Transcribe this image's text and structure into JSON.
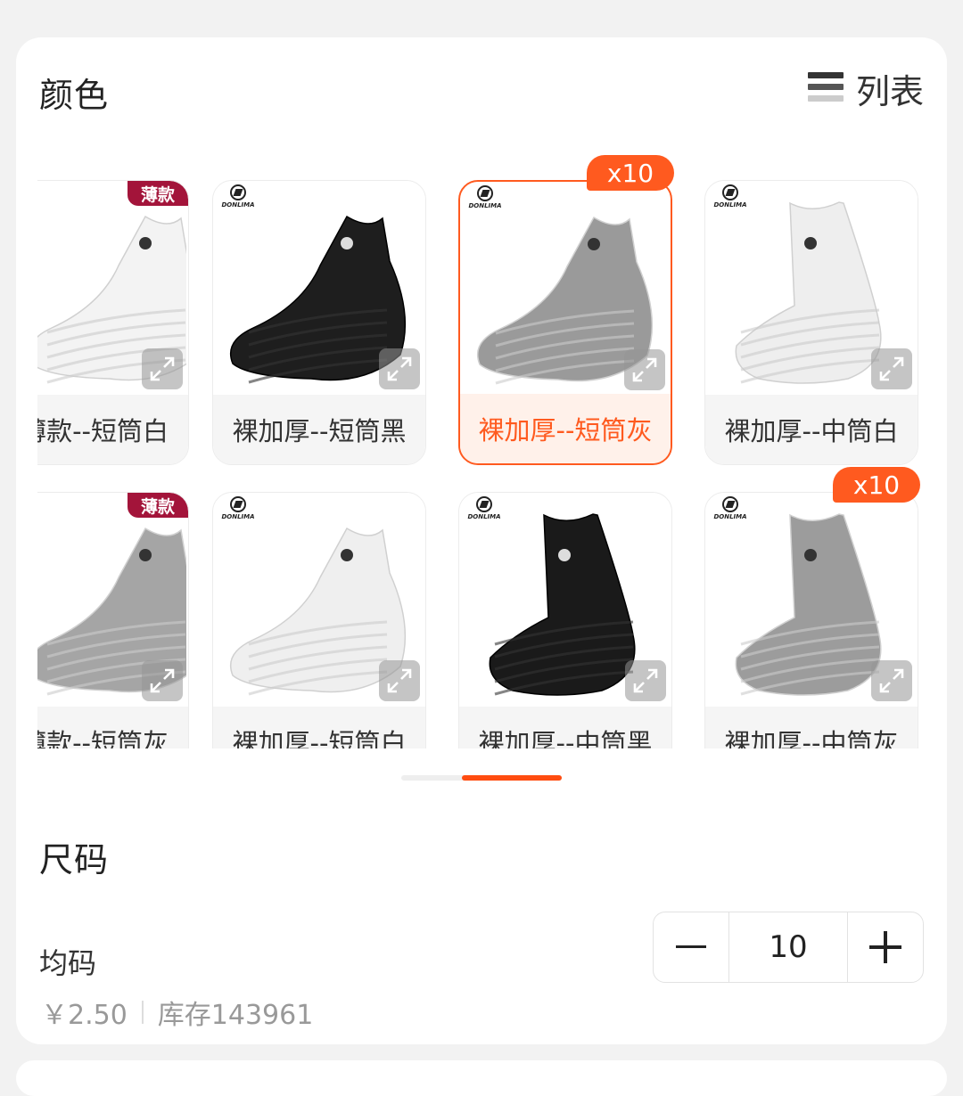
{
  "color_section": {
    "title": "颜色",
    "list_toggle_label": "列表",
    "items": [
      {
        "label": "薄款--短筒白",
        "display_label": "薄款--短筒白",
        "badge": "薄款",
        "qty_badge": "",
        "sock": "low",
        "shade": "#f3f3f3",
        "selected": false,
        "cut": true
      },
      {
        "label": "裸加厚--短筒黑",
        "display_label": "裸加厚--短筒黑",
        "badge": "",
        "qty_badge": "",
        "sock": "low",
        "shade": "#1e1e1e",
        "selected": false,
        "cut": false
      },
      {
        "label": "裸加厚--短筒灰",
        "display_label": "裸加厚--短筒灰",
        "badge": "",
        "qty_badge": "x10",
        "sock": "low",
        "shade": "#9a9a9a",
        "selected": true,
        "cut": false
      },
      {
        "label": "裸加厚--中筒白",
        "display_label": "裸加厚--中筒白",
        "badge": "",
        "qty_badge": "",
        "sock": "mid",
        "shade": "#eeeeee",
        "selected": false,
        "cut": false
      },
      {
        "label": "薄款--短筒灰",
        "display_label": "薄款--短筒灰",
        "badge": "薄款",
        "qty_badge": "",
        "sock": "low",
        "shade": "#a5a5a5",
        "selected": false,
        "cut": true
      },
      {
        "label": "裸加厚--短筒白",
        "display_label": "裸加厚--短筒白",
        "badge": "",
        "qty_badge": "",
        "sock": "low",
        "shade": "#efefef",
        "selected": false,
        "cut": false
      },
      {
        "label": "裸加厚--中筒黑",
        "display_label": "裸加厚--中筒黑",
        "badge": "",
        "qty_badge": "",
        "sock": "mid",
        "shade": "#1a1a1a",
        "selected": false,
        "cut": false
      },
      {
        "label": "裸加厚--中筒灰",
        "display_label": "裸加厚--中筒灰",
        "badge": "",
        "qty_badge": "x10",
        "sock": "mid",
        "shade": "#9c9c9c",
        "selected": false,
        "cut": false
      }
    ],
    "brand": "DONLIMA"
  },
  "size_section": {
    "title": "尺码",
    "option_name": "均码",
    "price": "￥2.50",
    "stock": "库存143961",
    "quantity": "10"
  },
  "colors": {
    "accent": "#ff5a1f",
    "thin_badge": "#a3143a",
    "card_bg": "#ffffff",
    "page_bg": "#f2f2f2"
  },
  "icons": {
    "list": "list-icon",
    "expand": "expand-icon",
    "minus": "minus-icon",
    "plus": "plus-icon"
  }
}
